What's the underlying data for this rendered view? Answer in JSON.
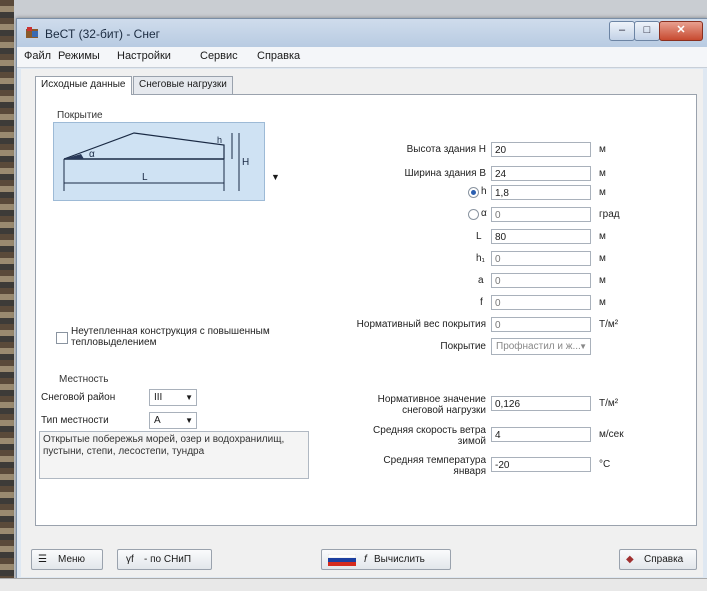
{
  "window": {
    "title": "ВеСТ (32-бит) - Снег"
  },
  "menu": [
    "Файл",
    "Режимы",
    "Настройки",
    "Сервис",
    "Справка"
  ],
  "tabs": [
    "Исходные данные",
    "Снеговые нагрузки"
  ],
  "roof": {
    "group_label": "Покрытие",
    "diagram_labels": {
      "h": "h",
      "H": "H",
      "alpha": "α",
      "L": "L"
    }
  },
  "params": {
    "height_label": "Высота здания H",
    "height_value": "20",
    "height_unit": "м",
    "width_label": "Ширина здания B",
    "width_value": "24",
    "width_unit": "м",
    "h_label": "h",
    "h_value": "1,8",
    "h_unit": "м",
    "alpha_label": "α",
    "alpha_value": "0",
    "alpha_unit": "град",
    "L_label": "L",
    "L_value": "80",
    "L_unit": "м",
    "h1_label": "h₁",
    "h1_value": "0",
    "h1_unit": "м",
    "a_label": "a",
    "a_value": "0",
    "a_unit": "м",
    "f_label": "f",
    "f_value": "0",
    "f_unit": "м",
    "weight_label": "Нормативный вес покрытия",
    "weight_value": "0",
    "weight_unit": "Т/м²",
    "cover_label": "Покрытие",
    "cover_value": "Профнастил и ж..."
  },
  "checkbox": {
    "label": "Неутепленная конструкция с повышенным тепловыделением",
    "checked": false
  },
  "terrain": {
    "group_label": "Местность",
    "snow_region_label": "Снеговой район",
    "snow_region_value": "III",
    "terrain_type_label": "Тип местности",
    "terrain_type_value": "A",
    "description": "Открытые побережья морей, озер и водохранилищ, пустыни, степи, лесостепи, тундра"
  },
  "climate": {
    "snow_load_label": "Нормативное значение снеговой нагрузки",
    "snow_load_value": "0,126",
    "snow_load_unit": "Т/м²",
    "wind_label": "Средняя скорость ветра зимой",
    "wind_value": "4",
    "wind_unit": "м/сек",
    "temp_label": "Средняя температура января",
    "temp_value": "-20",
    "temp_unit": "°C"
  },
  "buttons": {
    "menu": "Меню",
    "snip": "- по СНиП",
    "snip_symbol": "γf",
    "calculate": "Вычислить",
    "calculate_symbol": "f",
    "help": "Справка"
  },
  "colors": {
    "diagram_bg": "#cfe2f3",
    "title_bar": "#b8cbe2"
  }
}
